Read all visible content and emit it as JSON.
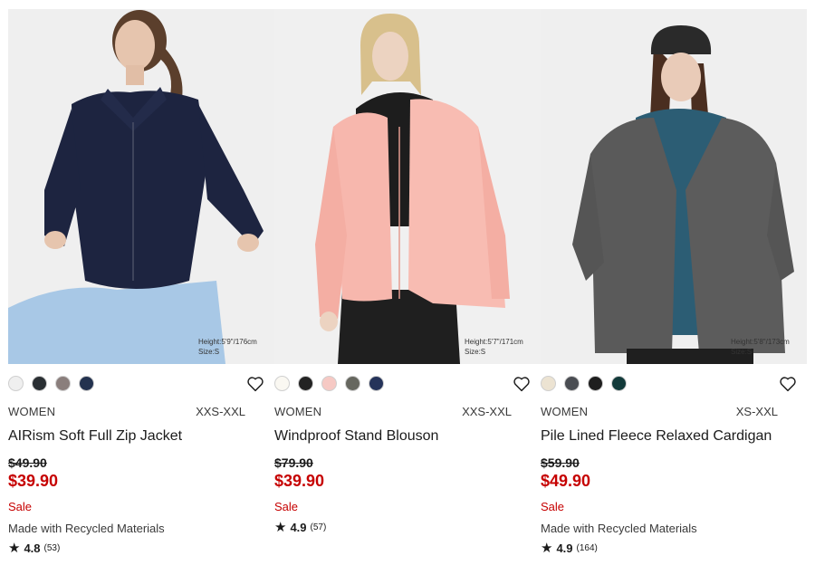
{
  "products": [
    {
      "name": "AIRism Soft Full Zip Jacket",
      "gender": "WOMEN",
      "sizes": "XXS-XXL",
      "original_price": "$49.90",
      "price": "$39.90",
      "flag": "Sale",
      "feature": "Made with Recycled Materials",
      "rating": "4.8",
      "review_count": "(53)",
      "model_height": "Height:5'9\"/176cm",
      "model_size": "Size:S",
      "swatches": [
        "#efefef",
        "#2a2f33",
        "#8a7e7c",
        "#23324f"
      ]
    },
    {
      "name": "Windproof Stand Blouson",
      "gender": "WOMEN",
      "sizes": "XXS-XXL",
      "original_price": "$79.90",
      "price": "$39.90",
      "flag": "Sale",
      "feature": "",
      "rating": "4.9",
      "review_count": "(57)",
      "model_height": "Height:5'7\"/171cm",
      "model_size": "Size:S",
      "swatches": [
        "#faf8f2",
        "#232323",
        "#f6c9c4",
        "#66675f",
        "#25335a"
      ]
    },
    {
      "name": "Pile Lined Fleece Relaxed Cardigan",
      "gender": "WOMEN",
      "sizes": "XS-XXL",
      "original_price": "$59.90",
      "price": "$49.90",
      "flag": "Sale",
      "feature": "Made with Recycled Materials",
      "rating": "4.9",
      "review_count": "(164)",
      "model_height": "Height:5'8\"/173cm",
      "model_size": "Size:S",
      "swatches": [
        "#ece3d2",
        "#4a4d52",
        "#1e1e1e",
        "#123a3a"
      ]
    }
  ],
  "icons": {
    "favorite": "heart-outline-icon",
    "rating": "star-icon"
  },
  "colors": {
    "sale": "#c60000",
    "text": "#1b1b1b"
  }
}
